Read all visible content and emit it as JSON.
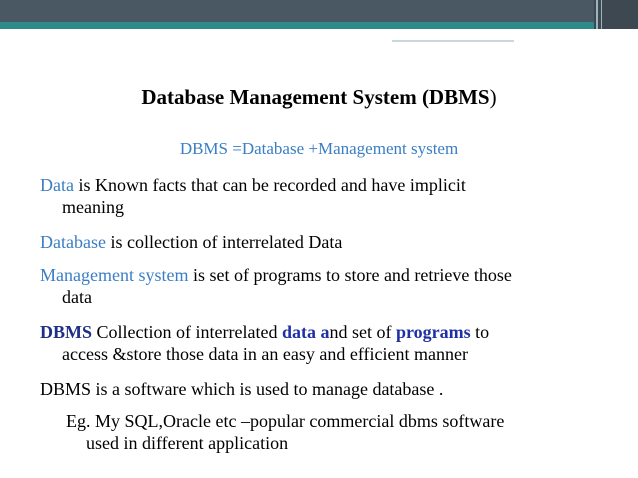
{
  "slide": {
    "title": "Database Management System (DBMS",
    "title_close": ")",
    "subtitle": "DBMS =Database +Management system",
    "p1": {
      "term": "Data",
      "text_line1": " is Known facts that can be recorded and have  implicit",
      "text_line2": "meaning"
    },
    "p2": {
      "term": "Database",
      "text": " is collection of interrelated Data"
    },
    "p3": {
      "term": "Management system",
      "text_line1": " is set of programs to store and retrieve those",
      "text_line2": "data"
    },
    "p4": {
      "term": "DBMS",
      "t1": " Collection of interrelated ",
      "k1": "data a",
      "t2": "nd set of ",
      "k2": "programs",
      "t3": " to",
      "line2": "access &store those data in an easy and efficient manner"
    },
    "p5": {
      "text": "DBMS is a software which is used to manage database ."
    },
    "p6": {
      "line1": "Eg. My SQL,Oracle etc –popular commercial  dbms software",
      "line2": "used in different application"
    }
  },
  "colors": {
    "term": "#3a7ec4",
    "dbms_term": "#1e2f86",
    "keyword": "#1f2fa5",
    "band": "#4a5864",
    "stripe": "#2e8b8b"
  }
}
